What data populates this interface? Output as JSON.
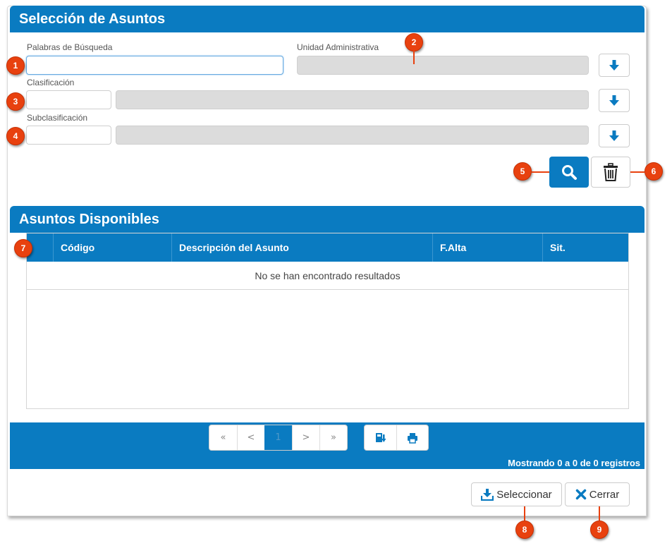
{
  "search_section": {
    "title": "Selección de Asuntos",
    "keywords_label": "Palabras de Búsqueda",
    "keywords_value": "",
    "admin_unit_label": "Unidad Administrativa",
    "admin_unit_value": "",
    "classification_label": "Clasificación",
    "classification_code": "",
    "classification_desc": "",
    "subclassification_label": "Subclasificación",
    "subclassification_code": "",
    "subclassification_desc": ""
  },
  "results_section": {
    "title": "Asuntos Disponibles",
    "columns": [
      "Código",
      "Descripción del Asunto",
      "F.Alta",
      "Sit."
    ],
    "empty_message": "No se han encontrado resultados"
  },
  "pager": {
    "first": "«",
    "prev": "<",
    "current_page": "1",
    "next": ">",
    "last": "»",
    "records_text": "Mostrando 0 a 0 de 0 registros"
  },
  "actions": {
    "select_label": "Seleccionar",
    "close_label": "Cerrar"
  },
  "callouts": [
    "1",
    "2",
    "3",
    "4",
    "5",
    "6",
    "7",
    "8",
    "9"
  ],
  "colors": {
    "primary": "#0a7bc1",
    "callout": "#e8410f",
    "readonly_bg": "#dcdcdc"
  },
  "icons": {
    "dropdown": "arrow-down-icon",
    "search": "search-icon",
    "clear": "trash-icon",
    "export": "export-file-icon",
    "print": "print-icon",
    "select": "download-icon",
    "close": "close-x-icon"
  }
}
